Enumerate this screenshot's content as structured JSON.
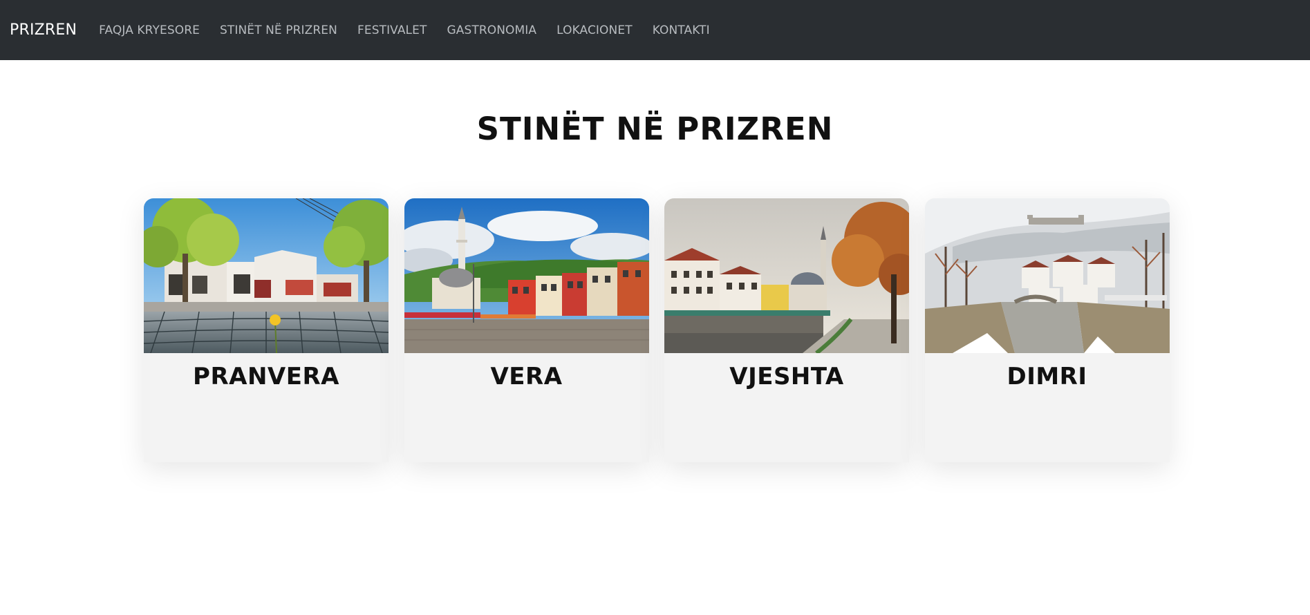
{
  "nav": {
    "brand": "PRIZREN",
    "links": [
      "FAQJA KRYESORE",
      "STINËT NË PRIZREN",
      "FESTIVALET",
      "GASTRONOMIA",
      "LOKACIONET",
      "KONTAKTI"
    ]
  },
  "main": {
    "title": "STINËT NË PRIZREN",
    "cards": [
      {
        "title": "PRANVERA"
      },
      {
        "title": "VERA"
      },
      {
        "title": "VJESHTA"
      },
      {
        "title": "DIMRI"
      }
    ]
  }
}
